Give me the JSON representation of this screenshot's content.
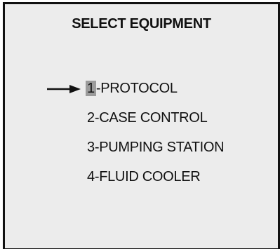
{
  "screen": {
    "title": "SELECT EQUIPMENT"
  },
  "menu": {
    "selected_index": 0,
    "items": [
      {
        "number": "1",
        "label": "-PROTOCOL"
      },
      {
        "number": "2",
        "label": "-CASE CONTROL"
      },
      {
        "number": "3",
        "label": "-PUMPING STATION"
      },
      {
        "number": "4",
        "label": "-FLUID COOLER"
      }
    ]
  },
  "colors": {
    "background": "#ececec",
    "border": "#111111",
    "text": "#111111",
    "selection_highlight": "#9b9b9b"
  },
  "icons": {
    "selection_pointer": "right-arrow-icon"
  }
}
